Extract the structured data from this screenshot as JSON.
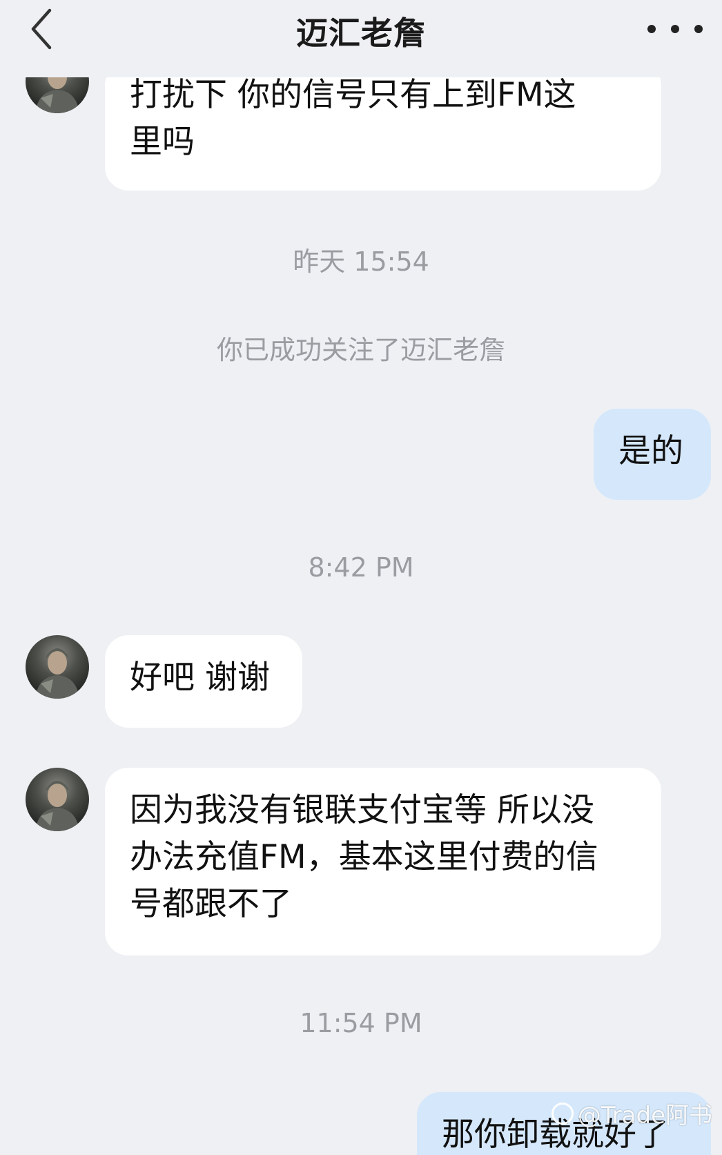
{
  "header": {
    "back_icon": "chevron-left-icon",
    "title": "迈汇老詹",
    "more_icon": "more-horizontal-icon"
  },
  "messages": [
    {
      "side": "left",
      "text_line1": "打扰下 你的信号只有上到FM这",
      "text_line2": "里吗"
    },
    {
      "side": "right",
      "text": "是的"
    },
    {
      "side": "left",
      "text": "好吧 谢谢"
    },
    {
      "side": "left",
      "text_line1": "因为我没有银联支付宝等 所以没",
      "text_line2": "办法充值FM，基本这里付费的信",
      "text_line3": "号都跟不了"
    },
    {
      "side": "right",
      "text": "那你卸载就好了"
    }
  ],
  "timestamps": [
    "昨天 15:54",
    "8:42 PM",
    "11:54 PM"
  ],
  "system_note": "你已成功关注了迈汇老詹",
  "watermark": "@Trade阿书",
  "colors": {
    "background": "#eef0f4",
    "incoming_bubble": "#ffffff",
    "outgoing_bubble": "#d5e8fb",
    "meta_text": "#9a9ca1"
  }
}
